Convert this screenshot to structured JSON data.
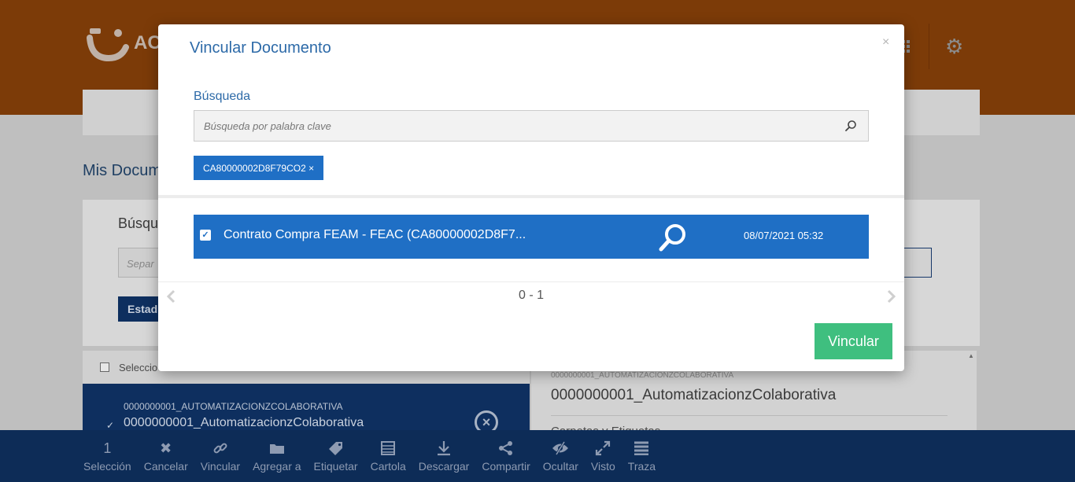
{
  "app": {
    "logo_text": "AC",
    "page_title": "Mis Docum",
    "search_label": "Búsque",
    "search_placeholder": "Separ",
    "estado_button": "Estad",
    "select_all_label": "Seleccio",
    "list_item": {
      "code": "0000000001_AUTOMATIZACIONZCOLABORATIVA",
      "name": "0000000001_AutomatizacionzColaborativa",
      "check": "✓"
    },
    "detail": {
      "code": "0000000001_AUTOMATIZACIONZCOLABORATIVA",
      "name": "0000000001_AutomatizacionzColaborativa",
      "section": "Carpetas y Etiquetas"
    }
  },
  "toolbar": {
    "items": [
      {
        "icon": "count",
        "value": "1",
        "label": "Selección"
      },
      {
        "icon": "close-icon",
        "value": "✖",
        "label": "Cancelar"
      },
      {
        "icon": "link-icon",
        "value": "",
        "label": "Vincular"
      },
      {
        "icon": "folder-icon",
        "value": "",
        "label": "Agregar a"
      },
      {
        "icon": "tag-icon",
        "value": "",
        "label": "Etiquetar"
      },
      {
        "icon": "table-icon",
        "value": "",
        "label": "Cartola"
      },
      {
        "icon": "download-icon",
        "value": "",
        "label": "Descargar"
      },
      {
        "icon": "share-icon",
        "value": "",
        "label": "Compartir"
      },
      {
        "icon": "eye-slash-icon",
        "value": "",
        "label": "Ocultar"
      },
      {
        "icon": "expand-icon",
        "value": "",
        "label": "Visto"
      },
      {
        "icon": "list-icon",
        "value": "",
        "label": "Traza"
      }
    ]
  },
  "modal": {
    "title": "Vincular Documento",
    "close": "×",
    "search_label": "Búsqueda",
    "search_placeholder": "Búsqueda por palabra clave",
    "tag": "CA80000002D8F79CO2 ×",
    "result": {
      "check": "✓",
      "title": "Contrato Compra FEAM - FEAC (CA80000002D8F7...",
      "date": "08/07/2021 05:32"
    },
    "pager": "0 - 1",
    "submit": "Vincular"
  },
  "colors": {
    "header_orange": "#f08a1c",
    "primary_blue": "#1f6fc5",
    "success_green": "#3fbf7f",
    "dark_navy": "#0d2c57"
  }
}
